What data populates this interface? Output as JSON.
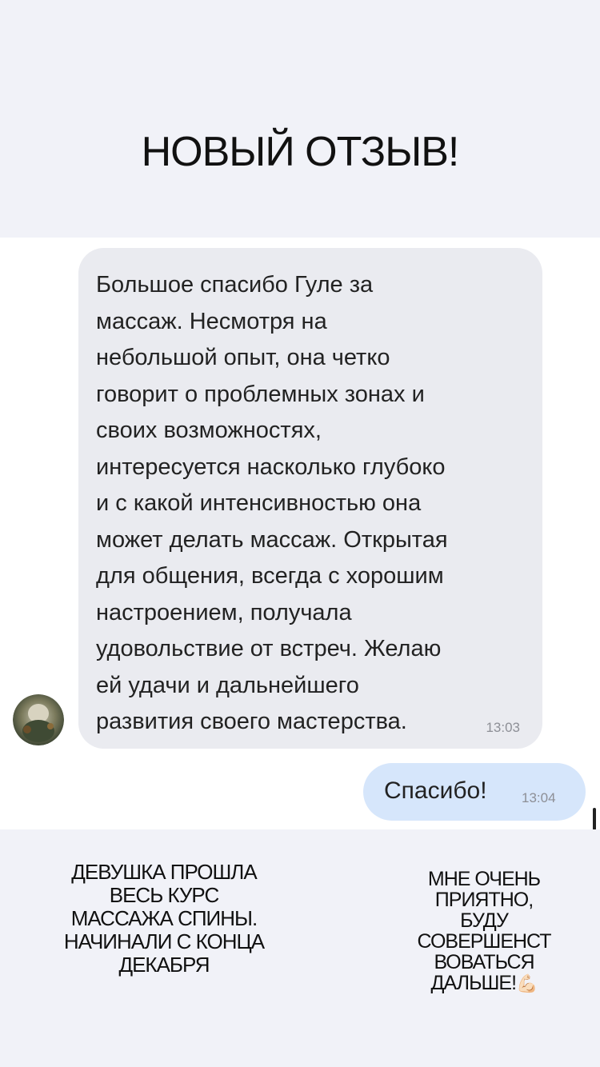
{
  "header": {
    "title": "НОВЫЙ ОТЗЫВ!"
  },
  "chat": {
    "incoming": {
      "text": "Большое спасибо Гуле за\nмассаж.  Несмотря на\nнебольшой опыт,  она четко\nговорит о проблемных зонах и\nсвоих возможностях,\nинтересуется  насколько глубоко\nи с какой интенсивностью она\nможет делать массаж. Открытая\nдля общения, всегда с хорошим\nнастроением, получала\nудовольствие от встреч.  Желаю\nей удачи и дальнейшего\nразвития своего мастерства.",
      "time": "13:03"
    },
    "outgoing": {
      "text": "Спасибо!",
      "time": "13:04"
    },
    "avatar_icon": "user-avatar"
  },
  "captions": {
    "left": "ДЕВУШКА ПРОШЛА\nВЕСЬ КУРС\nМАССАЖА СПИНЫ.\nНАЧИНАЛИ С КОНЦА\nДЕКАБРЯ",
    "right": "МНЕ ОЧЕНЬ\nПРИЯТНО,\nБУДУ\nСОВЕРШЕНСТ\nВОВАТЬСЯ\nДАЛЬШЕ!",
    "right_emoji": "💪🏻"
  },
  "colors": {
    "band_background": "#f1f2f8",
    "incoming_bubble": "#eaebf0",
    "outgoing_bubble": "#d6e6fb"
  }
}
